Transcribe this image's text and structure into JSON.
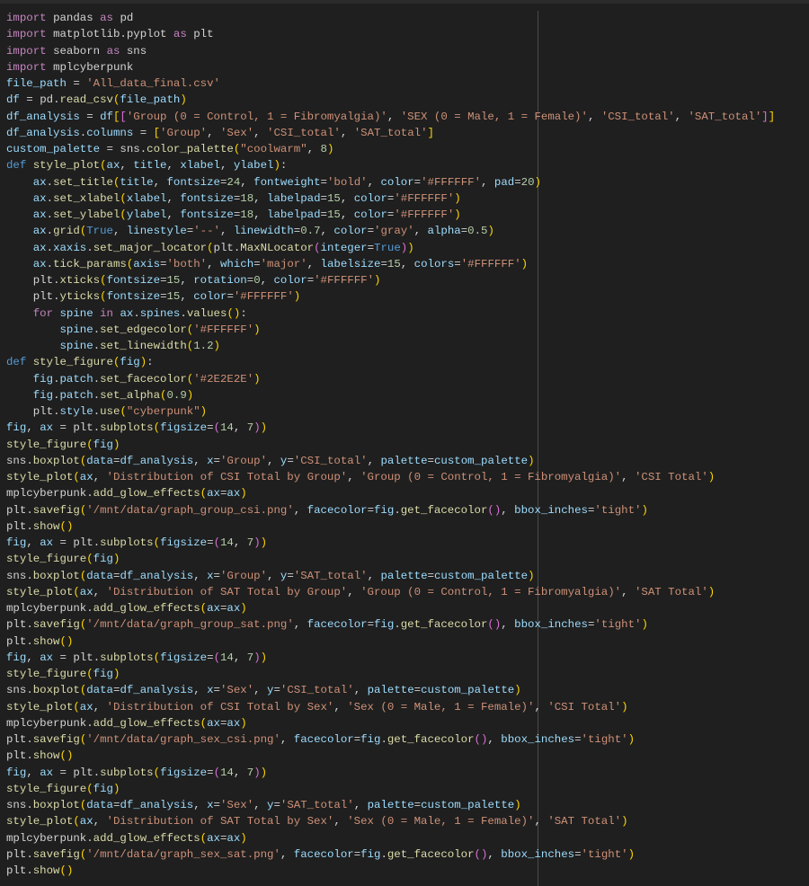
{
  "editor": {
    "language": "python",
    "lines": [
      "import pandas as pd",
      "import matplotlib.pyplot as plt",
      "import seaborn as sns",
      "import mplcyberpunk",
      "file_path = 'All_data_final.csv'",
      "df = pd.read_csv(file_path)",
      "df_analysis = df[['Group (0 = Control, 1 = Fibromyalgia)', 'SEX (0 = Male, 1 = Female)', 'CSI_total', 'SAT_total']]",
      "df_analysis.columns = ['Group', 'Sex', 'CSI_total', 'SAT_total']",
      "custom_palette = sns.color_palette(\"coolwarm\", 8)",
      "def style_plot(ax, title, xlabel, ylabel):",
      "    ax.set_title(title, fontsize=24, fontweight='bold', color='#FFFFFF', pad=20)",
      "    ax.set_xlabel(xlabel, fontsize=18, labelpad=15, color='#FFFFFF')",
      "    ax.set_ylabel(ylabel, fontsize=18, labelpad=15, color='#FFFFFF')",
      "    ax.grid(True, linestyle='--', linewidth=0.7, color='gray', alpha=0.5)",
      "    ax.xaxis.set_major_locator(plt.MaxNLocator(integer=True))",
      "    ax.tick_params(axis='both', which='major', labelsize=15, colors='#FFFFFF')",
      "    plt.xticks(fontsize=15, rotation=0, color='#FFFFFF')",
      "    plt.yticks(fontsize=15, color='#FFFFFF')",
      "    for spine in ax.spines.values():",
      "        spine.set_edgecolor('#FFFFFF')",
      "        spine.set_linewidth(1.2)",
      "def style_figure(fig):",
      "    fig.patch.set_facecolor('#2E2E2E')",
      "    fig.patch.set_alpha(0.9)",
      "    plt.style.use(\"cyberpunk\")",
      "fig, ax = plt.subplots(figsize=(14, 7))",
      "style_figure(fig)",
      "sns.boxplot(data=df_analysis, x='Group', y='CSI_total', palette=custom_palette)",
      "style_plot(ax, 'Distribution of CSI Total by Group', 'Group (0 = Control, 1 = Fibromyalgia)', 'CSI Total')",
      "mplcyberpunk.add_glow_effects(ax=ax)",
      "plt.savefig('/mnt/data/graph_group_csi.png', facecolor=fig.get_facecolor(), bbox_inches='tight')",
      "plt.show()",
      "fig, ax = plt.subplots(figsize=(14, 7))",
      "style_figure(fig)",
      "sns.boxplot(data=df_analysis, x='Group', y='SAT_total', palette=custom_palette)",
      "style_plot(ax, 'Distribution of SAT Total by Group', 'Group (0 = Control, 1 = Fibromyalgia)', 'SAT Total')",
      "mplcyberpunk.add_glow_effects(ax=ax)",
      "plt.savefig('/mnt/data/graph_group_sat.png', facecolor=fig.get_facecolor(), bbox_inches='tight')",
      "plt.show()",
      "fig, ax = plt.subplots(figsize=(14, 7))",
      "style_figure(fig)",
      "sns.boxplot(data=df_analysis, x='Sex', y='CSI_total', palette=custom_palette)",
      "style_plot(ax, 'Distribution of CSI Total by Sex', 'Sex (0 = Male, 1 = Female)', 'CSI Total')",
      "mplcyberpunk.add_glow_effects(ax=ax)",
      "plt.savefig('/mnt/data/graph_sex_csi.png', facecolor=fig.get_facecolor(), bbox_inches='tight')",
      "plt.show()",
      "fig, ax = plt.subplots(figsize=(14, 7))",
      "style_figure(fig)",
      "sns.boxplot(data=df_analysis, x='Sex', y='SAT_total', palette=custom_palette)",
      "style_plot(ax, 'Distribution of SAT Total by Sex', 'Sex (0 = Male, 1 = Female)', 'SAT Total')",
      "mplcyberpunk.add_glow_effects(ax=ax)",
      "plt.savefig('/mnt/data/graph_sex_sat.png', facecolor=fig.get_facecolor(), bbox_inches='tight')",
      "plt.show()"
    ]
  },
  "colors": {
    "background": "#1F1F1F",
    "keyword": "#C586C0",
    "storage": "#569CD6",
    "string": "#CE9178",
    "number": "#B5CEA8",
    "function": "#DCDCAA",
    "variable": "#9CDCFE"
  }
}
